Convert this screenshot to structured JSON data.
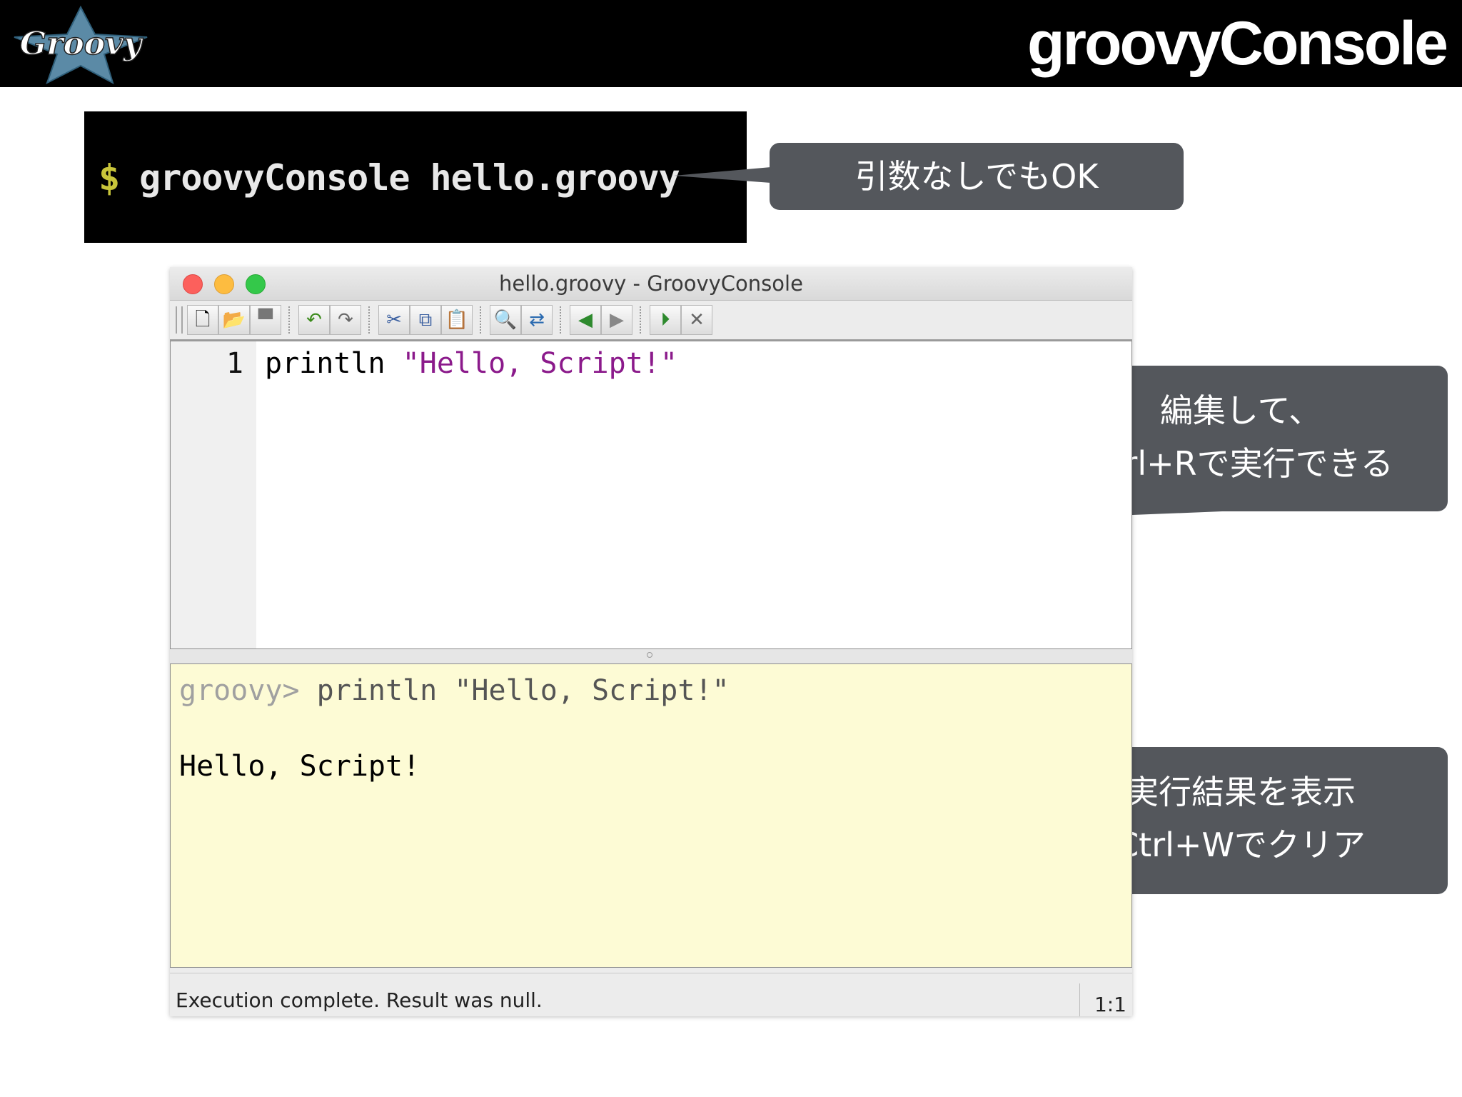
{
  "slide": {
    "title": "groovyConsole"
  },
  "logo": {
    "text": "Groovy",
    "icon": "groovy-star-logo"
  },
  "terminal": {
    "prompt": "$",
    "command": "groovyConsole hello.groovy"
  },
  "callouts": {
    "args": {
      "text": "引数なしでもOK"
    },
    "edit": {
      "line1": "編集して、",
      "line2": "Ctrl+Rで実行できる"
    },
    "result": {
      "line1": "実行結果を表示",
      "line2": "Ctrl+Wでクリア"
    }
  },
  "window": {
    "title": "hello.groovy - GroovyConsole",
    "toolbar": [
      {
        "name": "new-file-icon",
        "glyph": "🗋"
      },
      {
        "name": "open-file-icon",
        "glyph": "📂"
      },
      {
        "name": "save-icon",
        "glyph": "▀"
      },
      {
        "name": "undo-icon",
        "glyph": "↶"
      },
      {
        "name": "redo-icon",
        "glyph": "↷"
      },
      {
        "name": "cut-icon",
        "glyph": "✂"
      },
      {
        "name": "copy-icon",
        "glyph": "⧉"
      },
      {
        "name": "paste-icon",
        "glyph": "📋"
      },
      {
        "name": "find-icon",
        "glyph": "🔍"
      },
      {
        "name": "replace-icon",
        "glyph": "⇄"
      },
      {
        "name": "history-previous-icon",
        "glyph": "◀"
      },
      {
        "name": "history-next-icon",
        "glyph": "▶"
      },
      {
        "name": "run-script-icon",
        "glyph": "⏵"
      },
      {
        "name": "interrupt-icon",
        "glyph": "✕"
      }
    ],
    "editor": {
      "line_number": "1",
      "code_keyword": "println ",
      "code_string": "\"Hello, Script!\""
    },
    "output": {
      "prompt": "groovy>",
      "command": " println \"Hello, Script!\"",
      "result": "Hello, Script!"
    },
    "status": {
      "message": "Execution complete. Result was null.",
      "position": "1:1"
    }
  },
  "colors": {
    "callout_bg": "#54575c",
    "output_bg": "#fdfbd5",
    "string_color": "#8b1a8b",
    "terminal_prompt": "#c8c53a"
  }
}
